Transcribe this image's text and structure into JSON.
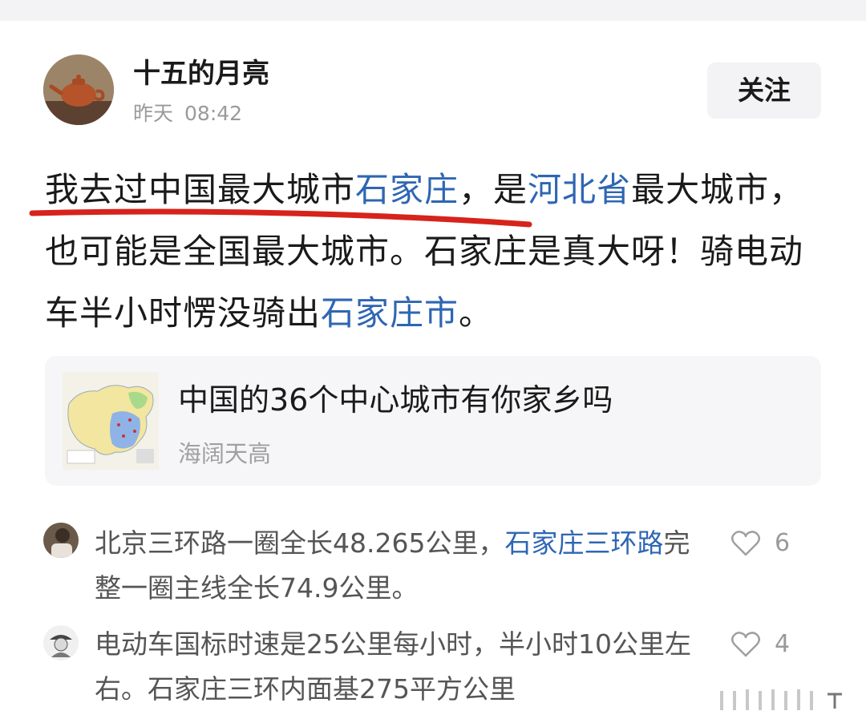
{
  "post": {
    "author": "十五的月亮",
    "date": "昨天",
    "time": "08:42",
    "follow_label": "关注",
    "text_parts": {
      "p1": "我去过中国最大城市",
      "link1": "石家庄",
      "p2": "，是",
      "link2": "河北省",
      "p3": "最大城市，也可能是全国最大城市。石家庄是真大呀！骑电动车半小时愣没骑出",
      "link3": "石家庄市",
      "p4": "。"
    },
    "link_color": "#2e66b3",
    "underline_color": "#d6231c"
  },
  "card": {
    "title": "中国的36个中心城市有你家乡吗",
    "source": "海阔天高"
  },
  "comments": [
    {
      "text_a": "北京三环路一圈全长48.265公里，",
      "link": "石家庄三环路",
      "text_b": "完整一圈主线全长74.9公里。",
      "likes": "6"
    },
    {
      "text": "电动车国标时速是25公里每小时，半小时10公里左右。石家庄三环内面基275平方公里",
      "likes": "4"
    }
  ],
  "icons": {
    "like": "heart-outline-icon",
    "thumbnail": "china-map-thumbnail"
  }
}
